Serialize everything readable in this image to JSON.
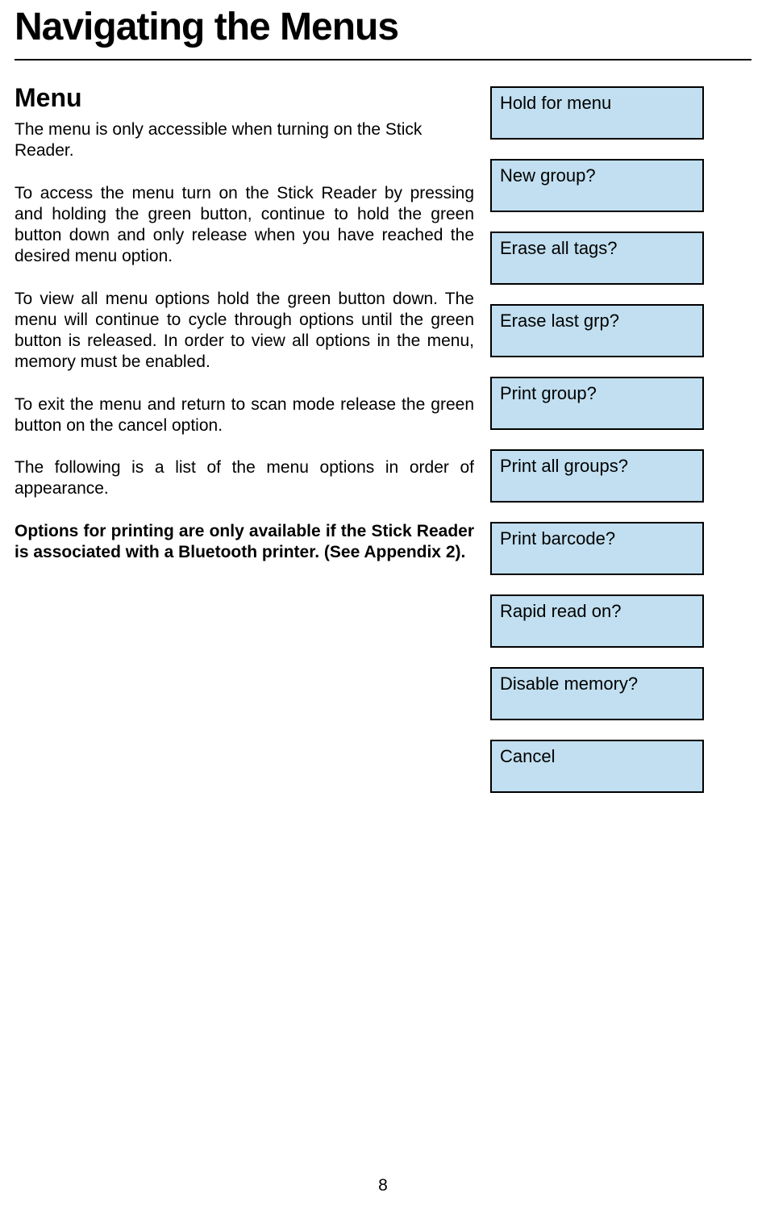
{
  "title": "Navigating the Menus",
  "section_heading": "Menu",
  "para1": "The menu is only accessible when turning on the Stick Reader.",
  "para2": "To access the menu turn on the Stick Reader by pressing and holding the green button, continue to hold the green button down and only release when you have reached the desired menu option.",
  "para3": "To view all menu options hold the green button down. The menu will continue to cycle through options until the green button is released. In order to view all options in the menu, memory must be enabled.",
  "para4": "To exit the menu and return to scan mode release the green button on the cancel option.",
  "para5": "The following is a list of the menu options in order of appearance.",
  "para6": "Options for printing are only available if the Stick Reader is associated with a Bluetooth printer. (See Appendix 2).",
  "menu_items": {
    "0": "Hold for menu",
    "1": "New group?",
    "2": "Erase all tags?",
    "3": "Erase last grp?",
    "4": "Print group?",
    "5": "Print all groups?",
    "6": "Print barcode?",
    "7": "Rapid read on?",
    "8": "Disable memory?",
    "9": "Cancel"
  },
  "page_number": "8"
}
